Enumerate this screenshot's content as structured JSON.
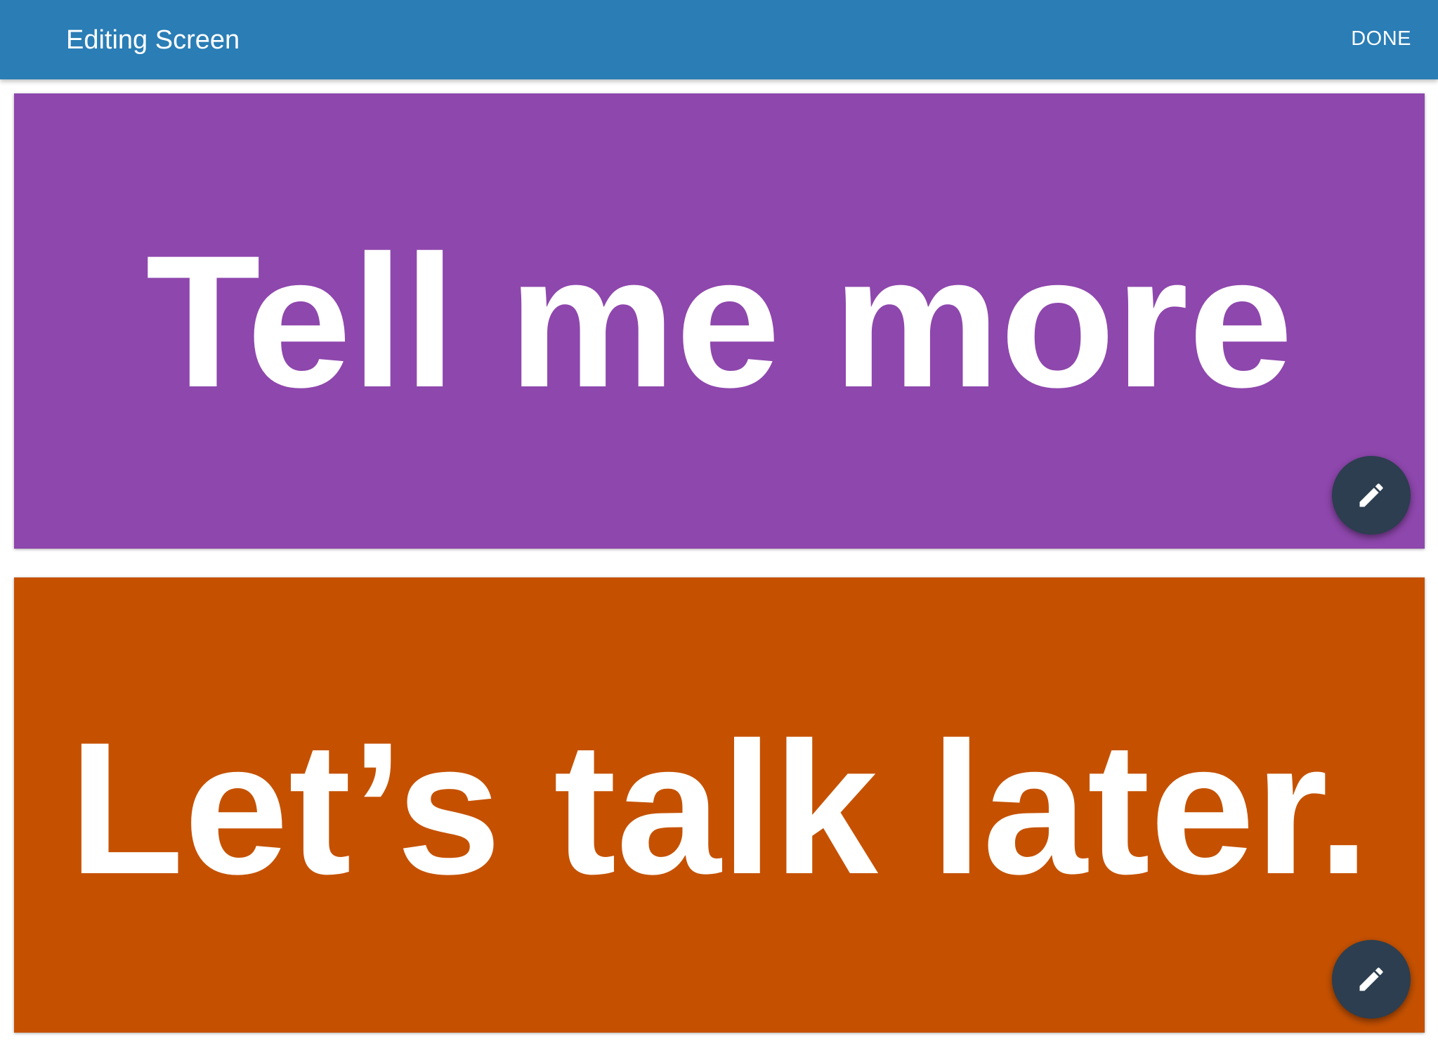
{
  "appbar": {
    "title": "Editing Screen",
    "done_label": "DONE",
    "color": "#2a7db5"
  },
  "cards": [
    {
      "text": "Tell me more",
      "color": "#8e47ad",
      "edit_icon": "pencil-icon"
    },
    {
      "text": "Let’s talk later.",
      "color": "#c55100",
      "edit_icon": "pencil-icon"
    }
  ],
  "fab_color": "#2c3e50"
}
